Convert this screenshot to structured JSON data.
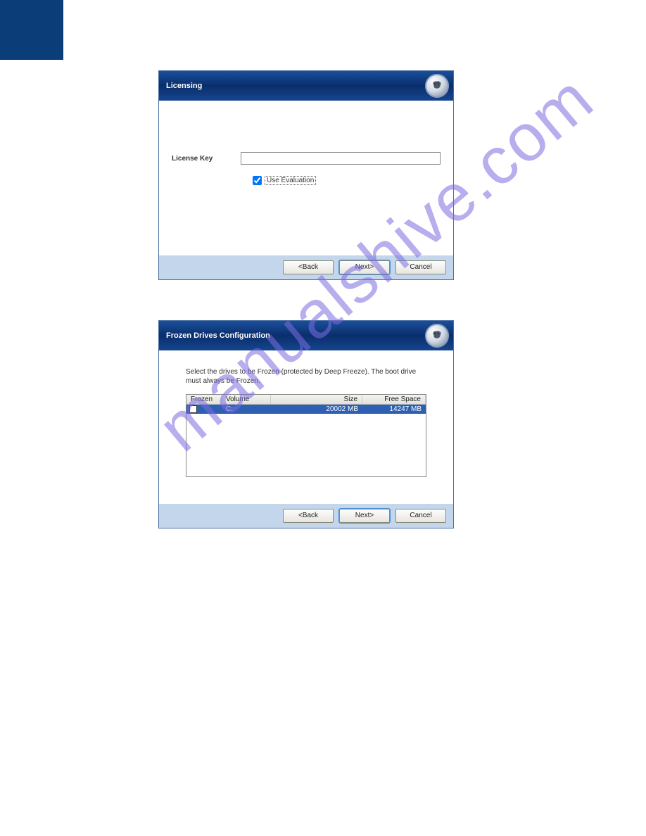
{
  "watermark": "manualshive.com",
  "dialog1": {
    "title": "Licensing",
    "license_label": "License Key",
    "evaluation_label": "Use Evaluation",
    "evaluation_checked": true,
    "buttons": {
      "back": "<Back",
      "next": "Next>",
      "cancel": "Cancel"
    }
  },
  "dialog2": {
    "title": "Frozen Drives Configuration",
    "description": "Select the drives to be Frozen (protected by Deep Freeze). The boot drive must always be Frozen.",
    "columns": {
      "frozen": "Frozen",
      "volume": "Volume",
      "size": "Size",
      "free": "Free Space"
    },
    "rows": [
      {
        "checked": false,
        "volume": "C:",
        "size": "20002 MB",
        "free": "14247 MB"
      }
    ],
    "buttons": {
      "back": "<Back",
      "next": "Next>",
      "cancel": "Cancel"
    }
  }
}
